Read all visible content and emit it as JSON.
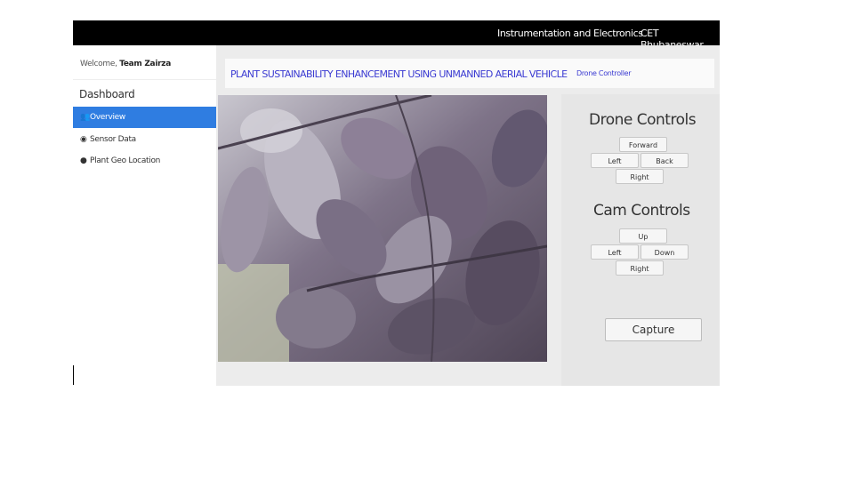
{
  "topbar": {
    "dept": "Instrumentation and Electronics",
    "college": "CET Bhubaneswar"
  },
  "sidebar": {
    "welcome_prefix": "Welcome,",
    "welcome_name": "Team Zairza",
    "heading": "Dashboard",
    "items": [
      {
        "label": "Overview",
        "icon": "users-icon",
        "active": true
      },
      {
        "label": "Sensor Data",
        "icon": "eye-icon",
        "active": false
      },
      {
        "label": "Plant Geo Location",
        "icon": "globe-icon",
        "active": false
      }
    ]
  },
  "main": {
    "title": "PLANT SUSTAINABILITY ENHANCEMENT USING UNMANNED AERIAL VEHICLE",
    "subtitle": "Drone Controller"
  },
  "drone_controls": {
    "heading": "Drone Controls",
    "forward": "Forward",
    "left": "Left",
    "back": "Back",
    "right": "Right"
  },
  "cam_controls": {
    "heading": "Cam Controls",
    "up": "Up",
    "left": "Left",
    "down": "Down",
    "right": "Right"
  },
  "capture_label": "Capture",
  "colors": {
    "topbar": "#000000",
    "active_nav": "#2f7de1",
    "title": "#3b3bd2",
    "panel": "#ececec"
  }
}
